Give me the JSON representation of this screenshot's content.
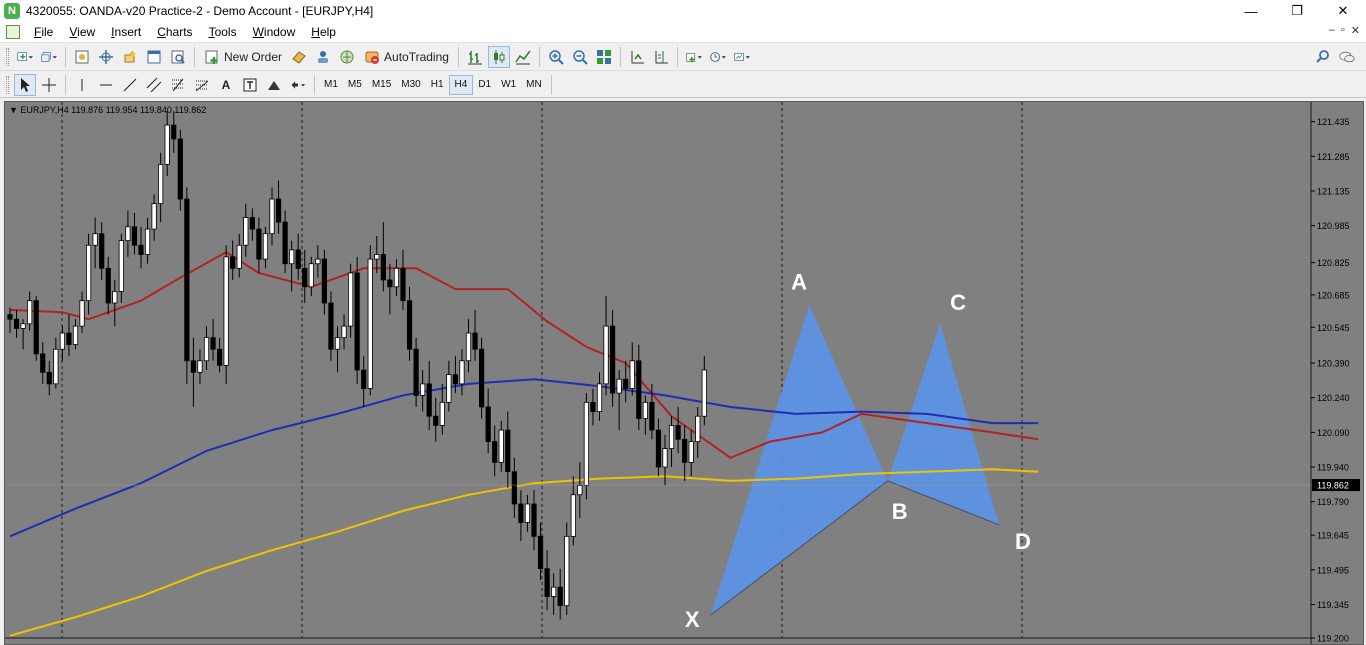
{
  "window": {
    "title": "4320055: OANDA-v20 Practice-2 - Demo Account - [EURJPY,H4]",
    "app_icon_letter": "N",
    "controls": {
      "minimize": "—",
      "maximize": "❐",
      "close": "✕"
    },
    "mdi_controls": {
      "minimize": "–",
      "restore": "▫",
      "close": "✕"
    }
  },
  "menu": {
    "items": [
      {
        "label": "File",
        "underline": "F",
        "rest": "ile"
      },
      {
        "label": "View",
        "underline": "V",
        "rest": "iew"
      },
      {
        "label": "Insert",
        "underline": "I",
        "rest": "nsert"
      },
      {
        "label": "Charts",
        "underline": "C",
        "rest": "harts"
      },
      {
        "label": "Tools",
        "underline": "T",
        "rest": "ools"
      },
      {
        "label": "Window",
        "underline": "W",
        "rest": "indow"
      },
      {
        "label": "Help",
        "underline": "H",
        "rest": "elp"
      }
    ]
  },
  "toolbar": {
    "new_order_label": "New Order",
    "autotrading_label": "AutoTrading"
  },
  "timeframes": [
    "M1",
    "M5",
    "M15",
    "M30",
    "H1",
    "H4",
    "D1",
    "W1",
    "MN"
  ],
  "active_timeframe": "H4",
  "chart": {
    "info": "▼ EURJPY,H4  119.876 119.954 119.840 119.862",
    "symbol": "EURJPY",
    "timeframe": "H4",
    "ohlc": {
      "open": 119.876,
      "high": 119.954,
      "low": 119.84,
      "close": 119.862
    },
    "current_price_label": "119.862",
    "background": "#808080",
    "price_ticks": [
      "121.435",
      "121.285",
      "121.135",
      "120.985",
      "120.825",
      "120.685",
      "120.545",
      "120.390",
      "120.240",
      "120.090",
      "119.940",
      "119.790",
      "119.645",
      "119.495",
      "119.345",
      "119.200"
    ],
    "pattern_labels": [
      "X",
      "A",
      "B",
      "C",
      "D"
    ],
    "colors": {
      "pattern_fill": "#5b94e8",
      "ma_fast": "#b22222",
      "ma_mid": "#1f2db5",
      "ma_slow": "#f2c200",
      "candle_bull": "#ffffff",
      "candle_bear": "#000000"
    }
  },
  "chart_data": {
    "type": "candlestick",
    "title": "",
    "price_range": [
      119.2,
      121.52
    ],
    "current_price": 119.862,
    "harmonic_pattern": {
      "X": {
        "bar": 107,
        "price": 119.3
      },
      "A": {
        "bar": 122,
        "price": 120.64
      },
      "B": {
        "bar": 134,
        "price": 119.88
      },
      "C": {
        "bar": 142,
        "price": 120.56
      },
      "D": {
        "bar": 151,
        "price": 119.69
      }
    },
    "moving_averages": [
      {
        "color": "#b22222",
        "points": [
          [
            0,
            120.62
          ],
          [
            8,
            120.61
          ],
          [
            12,
            120.58
          ],
          [
            20,
            120.66
          ],
          [
            26,
            120.76
          ],
          [
            33,
            120.87
          ],
          [
            38,
            120.78
          ],
          [
            46,
            120.72
          ],
          [
            54,
            120.8
          ],
          [
            62,
            120.8
          ],
          [
            68,
            120.71
          ],
          [
            76,
            120.71
          ],
          [
            82,
            120.57
          ],
          [
            88,
            120.46
          ],
          [
            94,
            120.39
          ],
          [
            101,
            120.16
          ],
          [
            110,
            119.98
          ],
          [
            116,
            120.05
          ],
          [
            124,
            120.09
          ],
          [
            130,
            120.17
          ],
          [
            140,
            120.13
          ],
          [
            150,
            120.09
          ],
          [
            157,
            120.06
          ]
        ]
      },
      {
        "color": "#1f2db5",
        "points": [
          [
            0,
            119.64
          ],
          [
            10,
            119.76
          ],
          [
            20,
            119.87
          ],
          [
            30,
            120.01
          ],
          [
            40,
            120.1
          ],
          [
            50,
            120.17
          ],
          [
            60,
            120.25
          ],
          [
            70,
            120.3
          ],
          [
            80,
            120.32
          ],
          [
            90,
            120.29
          ],
          [
            100,
            120.25
          ],
          [
            110,
            120.2
          ],
          [
            120,
            120.17
          ],
          [
            130,
            120.18
          ],
          [
            140,
            120.17
          ],
          [
            150,
            120.13
          ],
          [
            157,
            120.13
          ]
        ]
      },
      {
        "color": "#f2c200",
        "points": [
          [
            0,
            119.21
          ],
          [
            10,
            119.29
          ],
          [
            20,
            119.38
          ],
          [
            30,
            119.49
          ],
          [
            40,
            119.58
          ],
          [
            50,
            119.66
          ],
          [
            60,
            119.75
          ],
          [
            70,
            119.82
          ],
          [
            80,
            119.87
          ],
          [
            90,
            119.89
          ],
          [
            100,
            119.9
          ],
          [
            110,
            119.88
          ],
          [
            120,
            119.89
          ],
          [
            130,
            119.91
          ],
          [
            140,
            119.92
          ],
          [
            150,
            119.93
          ],
          [
            157,
            119.92
          ]
        ]
      }
    ],
    "candles_ohlc": [
      [
        120.6,
        120.63,
        120.52,
        120.58
      ],
      [
        120.58,
        120.62,
        120.5,
        120.54
      ],
      [
        120.54,
        120.58,
        120.45,
        120.56
      ],
      [
        120.56,
        120.7,
        120.53,
        120.66
      ],
      [
        120.66,
        120.68,
        120.4,
        120.43
      ],
      [
        120.43,
        120.48,
        120.3,
        120.35
      ],
      [
        120.35,
        120.4,
        120.25,
        120.3
      ],
      [
        120.3,
        120.5,
        120.28,
        120.45
      ],
      [
        120.45,
        120.55,
        120.4,
        120.52
      ],
      [
        120.52,
        120.6,
        120.42,
        120.47
      ],
      [
        120.47,
        120.58,
        120.45,
        120.55
      ],
      [
        120.55,
        120.7,
        120.52,
        120.66
      ],
      [
        120.66,
        120.95,
        120.6,
        120.9
      ],
      [
        120.9,
        121.02,
        120.8,
        120.95
      ],
      [
        120.95,
        121.0,
        120.75,
        120.8
      ],
      [
        120.8,
        120.85,
        120.6,
        120.65
      ],
      [
        120.65,
        120.75,
        120.55,
        120.7
      ],
      [
        120.7,
        120.95,
        120.65,
        120.92
      ],
      [
        120.92,
        121.05,
        120.85,
        120.98
      ],
      [
        120.98,
        121.04,
        120.86,
        120.9
      ],
      [
        120.9,
        120.98,
        120.8,
        120.86
      ],
      [
        120.86,
        121.02,
        120.82,
        120.97
      ],
      [
        120.97,
        121.12,
        120.92,
        121.08
      ],
      [
        121.08,
        121.3,
        121.0,
        121.25
      ],
      [
        121.25,
        121.48,
        121.2,
        121.42
      ],
      [
        121.42,
        121.48,
        121.3,
        121.36
      ],
      [
        121.36,
        121.4,
        121.05,
        121.1
      ],
      [
        121.1,
        121.15,
        120.3,
        120.4
      ],
      [
        120.4,
        120.5,
        120.2,
        120.35
      ],
      [
        120.35,
        120.45,
        120.3,
        120.4
      ],
      [
        120.4,
        120.55,
        120.36,
        120.5
      ],
      [
        120.5,
        120.58,
        120.4,
        120.45
      ],
      [
        120.45,
        120.5,
        120.35,
        120.38
      ],
      [
        120.38,
        120.9,
        120.3,
        120.85
      ],
      [
        120.85,
        120.92,
        120.75,
        120.8
      ],
      [
        120.8,
        120.95,
        120.76,
        120.9
      ],
      [
        120.9,
        121.08,
        120.85,
        121.02
      ],
      [
        121.02,
        121.06,
        120.92,
        120.97
      ],
      [
        120.97,
        121.02,
        120.78,
        120.84
      ],
      [
        120.84,
        120.98,
        120.8,
        120.95
      ],
      [
        120.95,
        121.15,
        120.9,
        121.1
      ],
      [
        121.1,
        121.18,
        120.95,
        121.0
      ],
      [
        121.0,
        121.05,
        120.78,
        120.82
      ],
      [
        120.82,
        120.92,
        120.7,
        120.88
      ],
      [
        120.88,
        120.95,
        120.75,
        120.8
      ],
      [
        120.8,
        120.88,
        120.65,
        120.72
      ],
      [
        120.72,
        120.85,
        120.68,
        120.82
      ],
      [
        120.82,
        120.9,
        120.76,
        120.84
      ],
      [
        120.84,
        120.88,
        120.6,
        120.65
      ],
      [
        120.65,
        120.7,
        120.4,
        120.45
      ],
      [
        120.45,
        120.55,
        120.35,
        120.5
      ],
      [
        120.5,
        120.6,
        120.45,
        120.55
      ],
      [
        120.55,
        120.82,
        120.5,
        120.78
      ],
      [
        120.78,
        120.85,
        120.3,
        120.36
      ],
      [
        120.36,
        120.42,
        120.2,
        120.28
      ],
      [
        120.28,
        120.9,
        120.25,
        120.84
      ],
      [
        120.84,
        120.94,
        120.78,
        120.86
      ],
      [
        120.86,
        121.0,
        120.7,
        120.75
      ],
      [
        120.75,
        120.82,
        120.6,
        120.72
      ],
      [
        120.72,
        120.84,
        120.68,
        120.8
      ],
      [
        120.8,
        120.88,
        120.62,
        120.66
      ],
      [
        120.66,
        120.72,
        120.4,
        120.45
      ],
      [
        120.45,
        120.5,
        120.2,
        120.25
      ],
      [
        120.25,
        120.36,
        120.18,
        120.3
      ],
      [
        120.3,
        120.4,
        120.1,
        120.16
      ],
      [
        120.16,
        120.24,
        120.05,
        120.12
      ],
      [
        120.12,
        120.3,
        120.08,
        120.22
      ],
      [
        120.22,
        120.4,
        120.18,
        120.34
      ],
      [
        120.34,
        120.42,
        120.26,
        120.3
      ],
      [
        120.3,
        120.45,
        120.25,
        120.4
      ],
      [
        120.4,
        120.58,
        120.35,
        120.52
      ],
      [
        120.52,
        120.62,
        120.4,
        120.45
      ],
      [
        120.45,
        120.5,
        120.15,
        120.2
      ],
      [
        120.2,
        120.28,
        120.0,
        120.05
      ],
      [
        120.05,
        120.12,
        119.9,
        119.96
      ],
      [
        119.96,
        120.14,
        119.92,
        120.1
      ],
      [
        120.1,
        120.18,
        119.85,
        119.92
      ],
      [
        119.92,
        119.98,
        119.72,
        119.78
      ],
      [
        119.78,
        119.84,
        119.62,
        119.7
      ],
      [
        119.7,
        119.82,
        119.66,
        119.78
      ],
      [
        119.78,
        119.84,
        119.58,
        119.64
      ],
      [
        119.64,
        119.7,
        119.45,
        119.5
      ],
      [
        119.5,
        119.58,
        119.32,
        119.38
      ],
      [
        119.38,
        119.48,
        119.3,
        119.42
      ],
      [
        119.42,
        119.5,
        119.28,
        119.34
      ],
      [
        119.34,
        119.7,
        119.3,
        119.64
      ],
      [
        119.64,
        119.9,
        119.6,
        119.82
      ],
      [
        119.82,
        119.96,
        119.72,
        119.86
      ],
      [
        119.86,
        120.26,
        119.8,
        120.22
      ],
      [
        120.22,
        120.28,
        120.12,
        120.18
      ],
      [
        120.18,
        120.35,
        120.14,
        120.3
      ],
      [
        120.3,
        120.68,
        120.25,
        120.55
      ],
      [
        120.55,
        120.62,
        120.2,
        120.26
      ],
      [
        120.26,
        120.36,
        120.1,
        120.32
      ],
      [
        120.32,
        120.4,
        120.22,
        120.28
      ],
      [
        120.28,
        120.48,
        120.25,
        120.4
      ],
      [
        120.4,
        120.47,
        120.1,
        120.15
      ],
      [
        120.15,
        120.25,
        120.08,
        120.22
      ],
      [
        120.22,
        120.3,
        120.06,
        120.1
      ],
      [
        120.1,
        120.15,
        119.9,
        119.94
      ],
      [
        119.94,
        120.08,
        119.86,
        120.02
      ],
      [
        120.02,
        120.16,
        119.94,
        120.12
      ],
      [
        120.12,
        120.2,
        120.0,
        120.06
      ],
      [
        120.06,
        120.12,
        119.88,
        119.96
      ],
      [
        119.96,
        120.1,
        119.9,
        120.05
      ],
      [
        120.05,
        120.2,
        119.98,
        120.16
      ],
      [
        120.16,
        120.42,
        120.12,
        120.36
      ]
    ]
  }
}
